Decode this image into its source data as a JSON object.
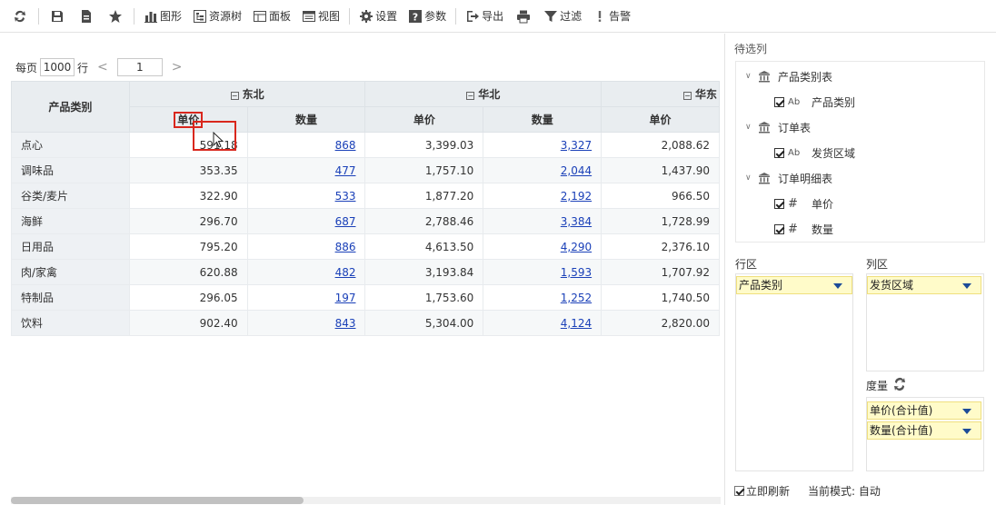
{
  "toolbar": {
    "refresh_icon": "refresh-icon",
    "save_icon": "save-icon",
    "saveas_icon": "save-as-icon",
    "favorite_icon": "star-icon",
    "chart_label": "图形",
    "resource_tree_label": "资源树",
    "panel_label": "面板",
    "view_label": "视图",
    "settings_label": "设置",
    "params_label": "参数",
    "export_label": "导出",
    "filter_label": "过滤",
    "alert_label": "告警"
  },
  "pager": {
    "per_page_label": "每页",
    "per_page_value": "1000",
    "rows_label": "行",
    "prev": "<",
    "page": "1",
    "next": ">"
  },
  "table": {
    "row_header": "产品类别",
    "regions": [
      "东北",
      "华北",
      "华东"
    ],
    "measures": [
      "单价",
      "数量",
      "单价",
      "数量",
      "单价"
    ],
    "rows": [
      {
        "category": "点心",
        "values": [
          "591.18",
          "868",
          "3,399.03",
          "3,327",
          "2,088.62"
        ]
      },
      {
        "category": "调味品",
        "values": [
          "353.35",
          "477",
          "1,757.10",
          "2,044",
          "1,437.90"
        ]
      },
      {
        "category": "谷类/麦片",
        "values": [
          "322.90",
          "533",
          "1,877.20",
          "2,192",
          "966.50"
        ]
      },
      {
        "category": "海鲜",
        "values": [
          "296.70",
          "687",
          "2,788.46",
          "3,384",
          "1,728.99"
        ]
      },
      {
        "category": "日用品",
        "values": [
          "795.20",
          "886",
          "4,613.50",
          "4,290",
          "2,376.10"
        ]
      },
      {
        "category": "肉/家禽",
        "values": [
          "620.88",
          "482",
          "3,193.84",
          "1,593",
          "1,707.92"
        ]
      },
      {
        "category": "特制品",
        "values": [
          "296.05",
          "197",
          "1,753.60",
          "1,252",
          "1,740.50"
        ]
      },
      {
        "category": "饮料",
        "values": [
          "902.40",
          "843",
          "5,304.00",
          "4,124",
          "2,820.00"
        ]
      }
    ]
  },
  "panel": {
    "title": "待选列",
    "tree": {
      "t1": "产品类别表",
      "t1_f1": "产品类别",
      "t2": "订单表",
      "t2_f1": "发货区域",
      "t3": "订单明细表",
      "t3_f1": "单价",
      "t3_f2": "数量",
      "text_type": "Ab",
      "num_type": "#"
    },
    "row_zone_label": "行区",
    "col_zone_label": "列区",
    "row_pill": "产品类别",
    "col_pill": "发货区域",
    "measure_label": "度量",
    "measure_pill_1": "单价(合计值)",
    "measure_pill_2": "数量(合计值)",
    "instant_refresh": "立即刷新",
    "mode_label": "当前模式: 自动"
  },
  "colors": {
    "accent_red": "#d9271d",
    "link": "#1a40b8",
    "pill_bg": "#fffbc9",
    "header_bg": "#e9edf0"
  }
}
